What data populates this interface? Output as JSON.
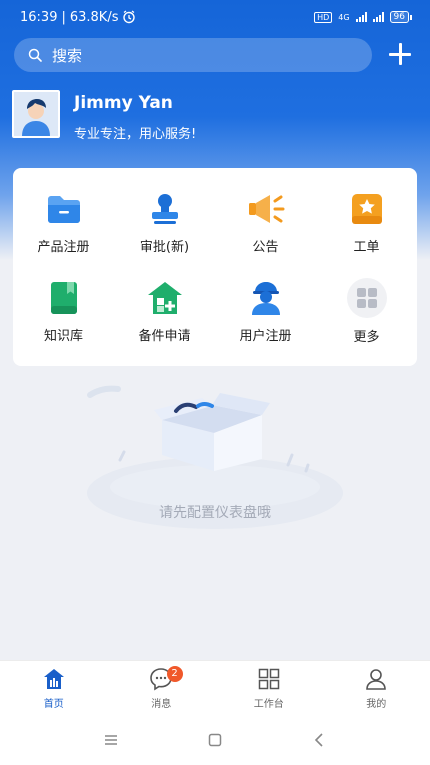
{
  "status_bar": {
    "time": "16:39",
    "speed": "63.8K/s",
    "hd_label": "HD",
    "net_label": "4G",
    "battery": "96"
  },
  "search": {
    "placeholder": "搜索"
  },
  "profile": {
    "name": "Jimmy Yan",
    "motto": "专业专注，用心服务!"
  },
  "grid": {
    "items": [
      {
        "label": "产品注册",
        "icon": "folder-icon",
        "color": "#2f86e8"
      },
      {
        "label": "审批(新)",
        "icon": "stamp-icon",
        "color": "#1c6fd6"
      },
      {
        "label": "公告",
        "icon": "megaphone-icon",
        "color": "#f39a1e"
      },
      {
        "label": "工单",
        "icon": "ticket-icon",
        "color": "#f4a020"
      },
      {
        "label": "知识库",
        "icon": "book-icon",
        "color": "#1fae6c"
      },
      {
        "label": "备件申请",
        "icon": "warehouse-icon",
        "color": "#1fae6c"
      },
      {
        "label": "用户注册",
        "icon": "worker-icon",
        "color": "#1c6fd6"
      },
      {
        "label": "更多",
        "icon": "more-grid-icon",
        "color": "#b8bcc6"
      }
    ]
  },
  "empty_state": {
    "text": "请先配置仪表盘哦"
  },
  "tabbar": {
    "tabs": [
      {
        "label": "首页",
        "icon": "home-icon"
      },
      {
        "label": "消息",
        "icon": "message-icon",
        "badge": "2"
      },
      {
        "label": "工作台",
        "icon": "workbench-icon"
      },
      {
        "label": "我的",
        "icon": "profile-icon"
      }
    ]
  },
  "colors": {
    "primary": "#1565d8",
    "accent_active": "#1a5fc9",
    "badge": "#f0582a"
  }
}
